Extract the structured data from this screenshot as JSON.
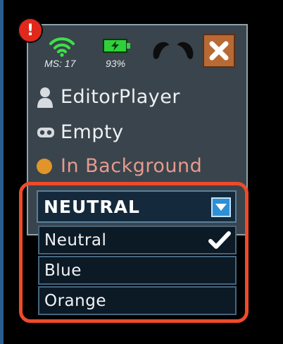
{
  "colors": {
    "panel": "#3a444c",
    "accent": "#2f8fd6",
    "alert": "#e0281c",
    "highlight": "#ef4a2a",
    "close": "#b86a35"
  },
  "status": {
    "alert_glyph": "!",
    "ping": "MS: 17",
    "battery": "93%",
    "wifi_icon": "wifi-icon",
    "battery_icon": "battery-charging-icon",
    "controller_icon": "gamepad-icon",
    "close_icon": "close-icon"
  },
  "info": {
    "player": "EditorPlayer",
    "slot": "Empty",
    "state": "In Background"
  },
  "team_dropdown": {
    "selected": "NEUTRAL",
    "options": [
      {
        "label": "Neutral",
        "checked": true
      },
      {
        "label": "Blue",
        "checked": false
      },
      {
        "label": "Orange",
        "checked": false
      }
    ]
  }
}
